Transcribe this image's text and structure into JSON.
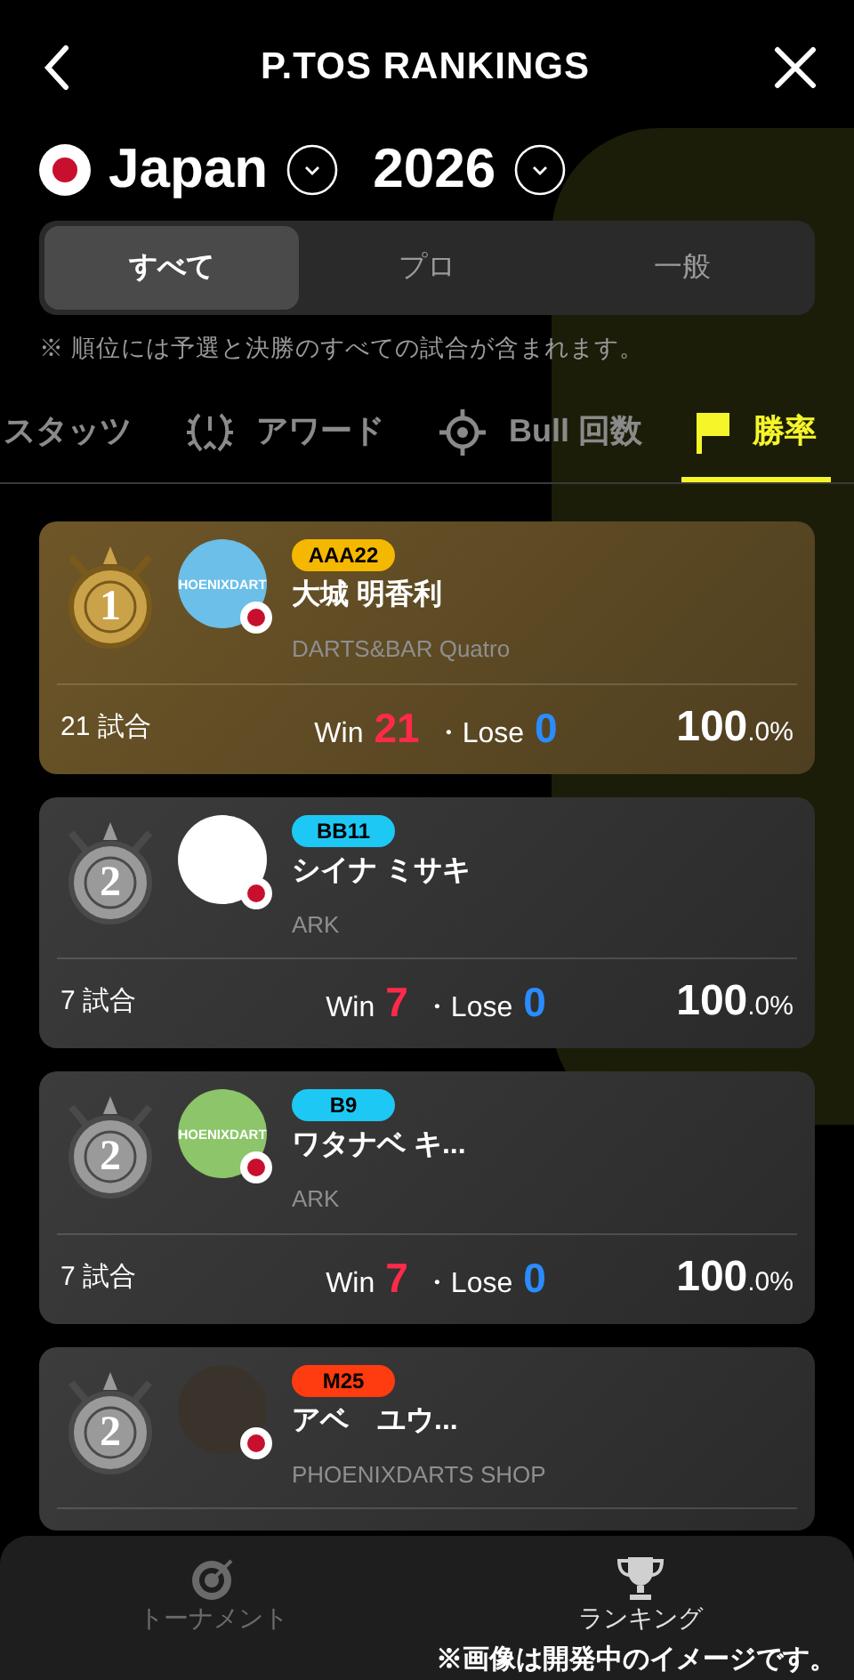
{
  "header": {
    "title": "P.TOS RANKINGS"
  },
  "filters": {
    "country": "Japan",
    "year": "2026"
  },
  "segments": [
    {
      "label": "すべて",
      "selected": true
    },
    {
      "label": "プロ",
      "selected": false
    },
    {
      "label": "一般",
      "selected": false
    }
  ],
  "note": "※ 順位には予選と決勝のすべての試合が含まれます。",
  "tabs": [
    {
      "label": "スタッツ",
      "kind": "stats",
      "selected": false
    },
    {
      "label": "アワード",
      "kind": "award",
      "selected": false
    },
    {
      "label": "Bull 回数",
      "kind": "bull",
      "selected": false
    },
    {
      "label": "勝率",
      "kind": "winrate",
      "selected": true
    }
  ],
  "rankings": [
    {
      "rank": "1",
      "kind": "gold",
      "avatar_text": "HOENIXDART",
      "badge": "AAA22",
      "color": "#f5b800",
      "name": "大城 明香利",
      "shop": "DARTS&BAR Quatro",
      "matches": "21 試合",
      "win_label": "Win",
      "wins": "21",
      "lose_label": "・Lose",
      "losses": "0",
      "rate_main": "100",
      "rate_decimal": ".0%"
    },
    {
      "rank": "2",
      "kind": "silver",
      "badge": "BB11",
      "color": "#1ec8f5",
      "name": "シイナ ミサキ",
      "shop": "ARK",
      "matches": "7 試合",
      "win_label": "Win",
      "wins": "7",
      "lose_label": "・Lose",
      "losses": "0",
      "rate_main": "100",
      "rate_decimal": ".0%"
    },
    {
      "rank": "2",
      "kind": "silver",
      "avatar_text": "HOENIXDART",
      "badge": "B9",
      "color": "#1ec8f5",
      "name": "ワタナベ キ...",
      "shop": "ARK",
      "matches": "7 試合",
      "win_label": "Win",
      "wins": "7",
      "lose_label": "・Lose",
      "losses": "0",
      "rate_main": "100",
      "rate_decimal": ".0%"
    },
    {
      "rank": "2",
      "kind": "silver",
      "badge": "M25",
      "color": "#ff3b10",
      "name": "アベ　ユウ...",
      "shop": "PHOENIXDARTS SHOP"
    }
  ],
  "bottom_nav": [
    {
      "label": "トーナメント",
      "kind": "target",
      "selected": false
    },
    {
      "label": "ランキング",
      "kind": "trophy",
      "selected": true
    }
  ],
  "image_notice": "※画像は開発中のイメージです。"
}
